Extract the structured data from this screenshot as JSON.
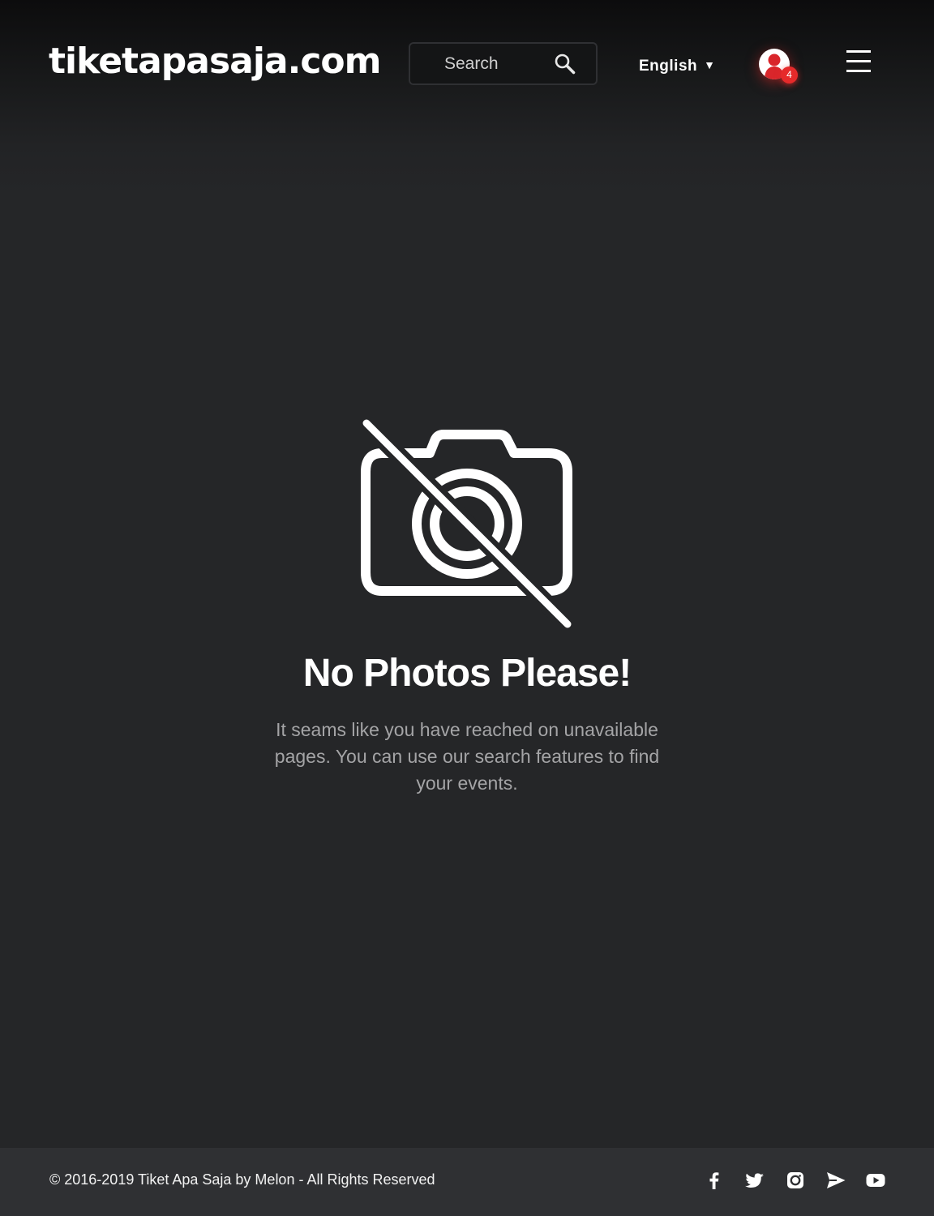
{
  "header": {
    "logo_text": "tiketapasaja.com",
    "search": {
      "placeholder": "Search",
      "value": ""
    },
    "language": {
      "selected": "English"
    },
    "notifications": {
      "count": "4"
    }
  },
  "main": {
    "icon": "camera-off-icon",
    "title": "No Photos Please!",
    "description": "It seams like you have reached on unavailable pages. You can use our search features to find your events."
  },
  "footer": {
    "copyright": "© 2016-2019 Tiket Apa Saja by Melon - All Rights Reserved",
    "social_icons": [
      "facebook-icon",
      "twitter-icon",
      "instagram-icon",
      "telegram-icon",
      "youtube-icon"
    ]
  },
  "colors": {
    "background": "#252628",
    "header_dark": "#0c0c0d",
    "footer": "#2f3033",
    "accent_red": "#e62a2a",
    "text_primary": "#ffffff",
    "text_muted": "#a4a4a6"
  }
}
